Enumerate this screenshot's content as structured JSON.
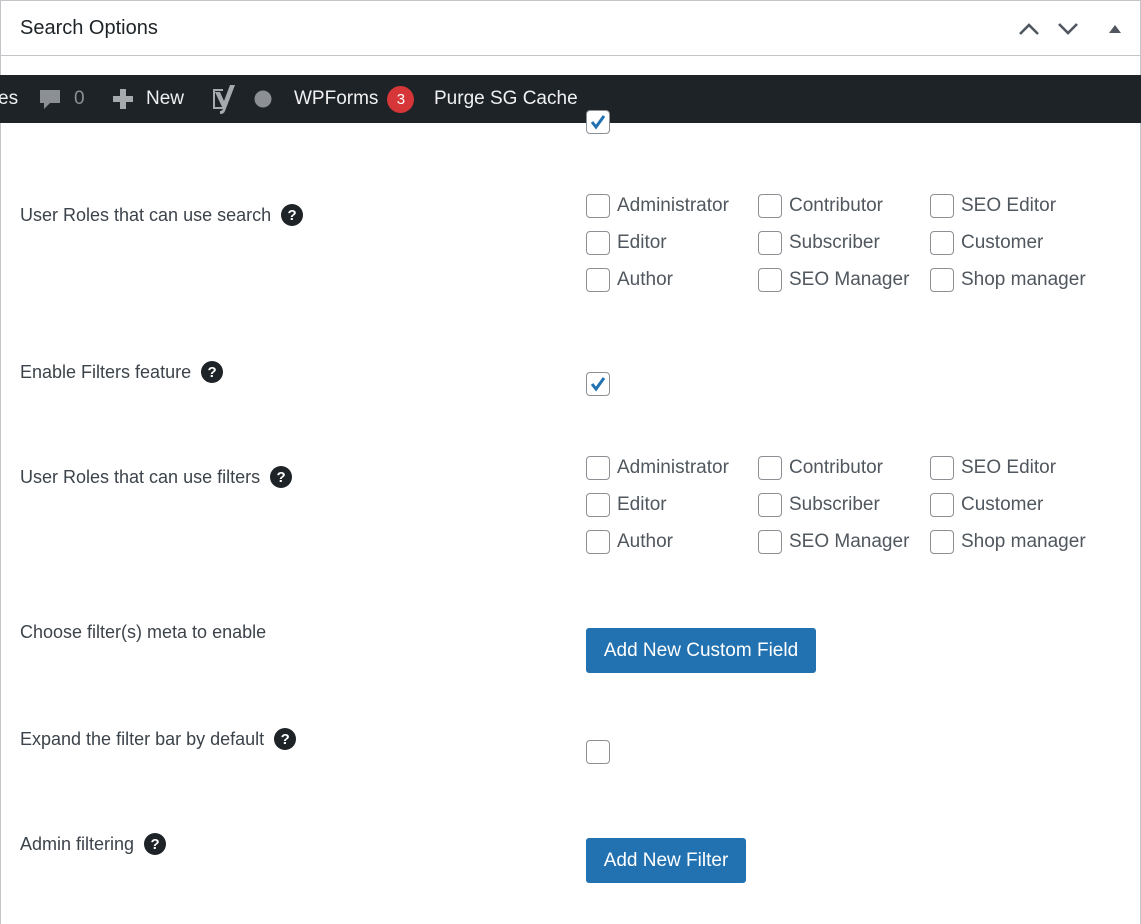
{
  "panel": {
    "title": "Search Options"
  },
  "adminbar": {
    "cut_text": "es",
    "comments_count": "0",
    "new_label": "New",
    "wpforms_label": "WPForms",
    "wpforms_badge": "3",
    "purge_label": "Purge SG Cache"
  },
  "rows": {
    "search_roles": {
      "label": "User Roles that can use search",
      "roles": [
        "Administrator",
        "Contributor",
        "SEO Editor",
        "Editor",
        "Subscriber",
        "Customer",
        "Author",
        "SEO Manager",
        "Shop manager"
      ]
    },
    "filters_feature": {
      "label": "Enable Filters feature",
      "checked": true
    },
    "filter_roles": {
      "label": "User Roles that can use filters",
      "roles": [
        "Administrator",
        "Contributor",
        "SEO Editor",
        "Editor",
        "Subscriber",
        "Customer",
        "Author",
        "SEO Manager",
        "Shop manager"
      ]
    },
    "filter_meta": {
      "label": "Choose filter(s) meta to enable",
      "button": "Add New Custom Field"
    },
    "expand_bar": {
      "label": "Expand the filter bar by default",
      "checked": false
    },
    "admin_filtering": {
      "label": "Admin filtering",
      "button": "Add New Filter"
    }
  },
  "help_glyph": "?",
  "colors": {
    "accent": "#2271b1",
    "adminbar": "#1d2327",
    "badge": "#d63638"
  }
}
